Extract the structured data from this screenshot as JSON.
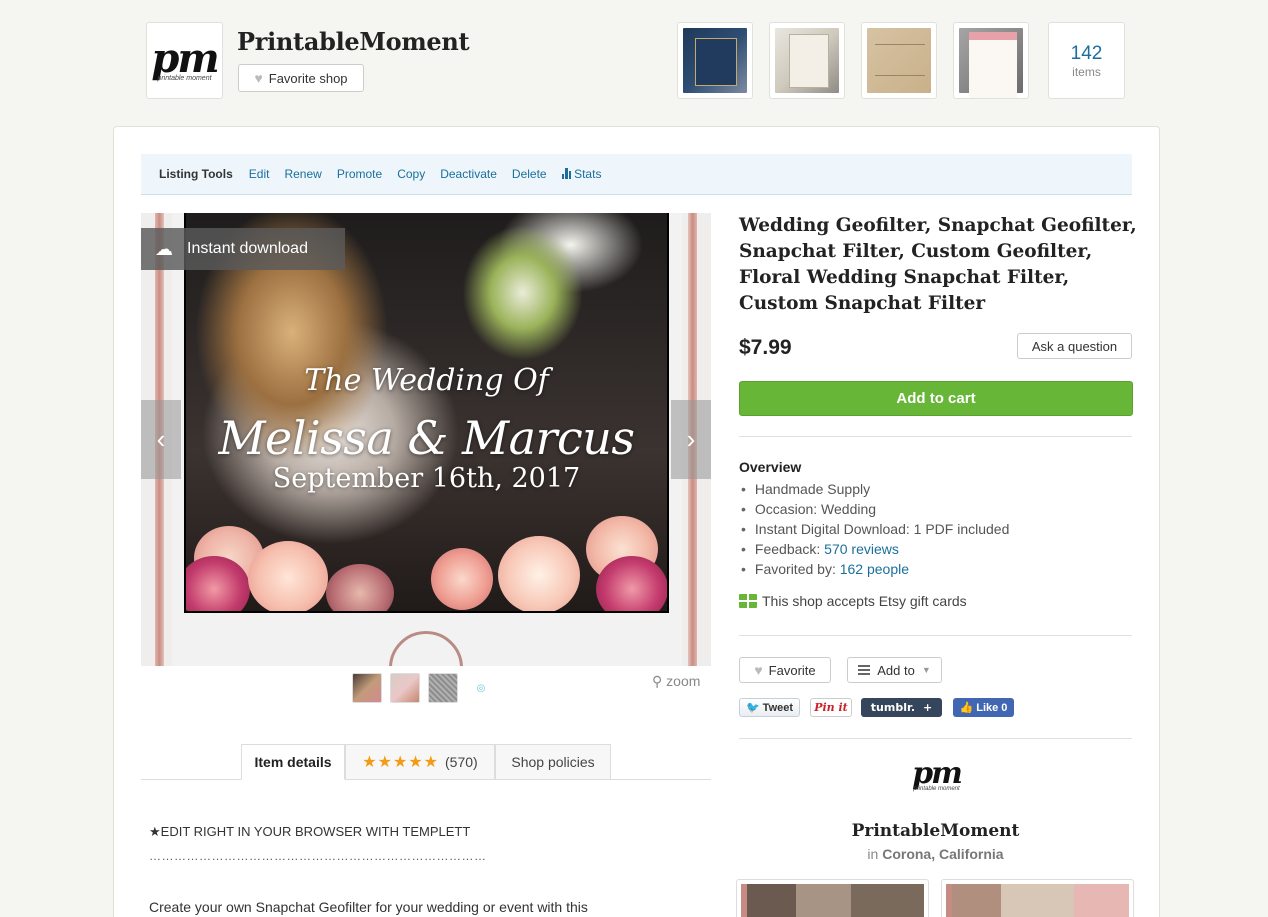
{
  "header": {
    "logo_mark": "pm",
    "logo_sub": "printable moment",
    "shop_name": "PrintableMoment",
    "favorite_shop_label": "Favorite shop",
    "item_count": "142",
    "item_count_label": "items"
  },
  "listing_tools": {
    "lead": "Listing Tools",
    "links": [
      "Edit",
      "Renew",
      "Promote",
      "Copy",
      "Deactivate",
      "Delete"
    ],
    "stats_label": "Stats"
  },
  "image": {
    "badge": "Instant download",
    "line1": "The Wedding Of",
    "line2": "Melissa & Marcus",
    "line3": "September 16th, 2017",
    "prev_arrow": "‹",
    "next_arrow": "›",
    "zoom_label": "zoom"
  },
  "tabs": {
    "item_details": "Item details",
    "reviews_stars": "★★★★★",
    "reviews_count": "(570)",
    "shop_policies": "Shop policies"
  },
  "description": {
    "line1": "★EDIT RIGHT IN YOUR BROWSER WITH TEMPLETT",
    "line2": "………………………………………………………………………",
    "line3": "Create your own Snapchat Geofilter for your wedding or event with this"
  },
  "listing": {
    "title": "Wedding Geofilter, Snapchat Geofilter, Snapchat Filter, Custom Geofilter, Floral Wedding Snapchat Filter, Custom Snapchat Filter",
    "price": "$7.99",
    "ask_label": "Ask a question",
    "cart_label": "Add to cart"
  },
  "overview": {
    "title": "Overview",
    "handmade": "Handmade Supply",
    "occasion": "Occasion: Wedding",
    "download": "Instant Digital Download: 1 PDF included",
    "feedback_prefix": "Feedback: ",
    "feedback_link": "570 reviews",
    "favorited_prefix": "Favorited by: ",
    "favorited_link": "162 people",
    "gift_text": "This shop accepts Etsy gift cards"
  },
  "actions": {
    "favorite_label": "Favorite",
    "add_to_label": "Add to"
  },
  "social": {
    "tweet": "Tweet",
    "pinit": "Pin it",
    "tumblr": "tumblr.",
    "tumblr_plus": "+",
    "fb_like": "Like",
    "fb_count": "0"
  },
  "shop_card": {
    "logo_mark": "pm",
    "logo_sub": "printable moment",
    "name": "PrintableMoment",
    "location_prefix": "in ",
    "location": "Corona, California"
  },
  "colors": {
    "accent_link": "#1a6f9c",
    "cart_green": "#67b638",
    "star_orange": "#f29b14"
  }
}
